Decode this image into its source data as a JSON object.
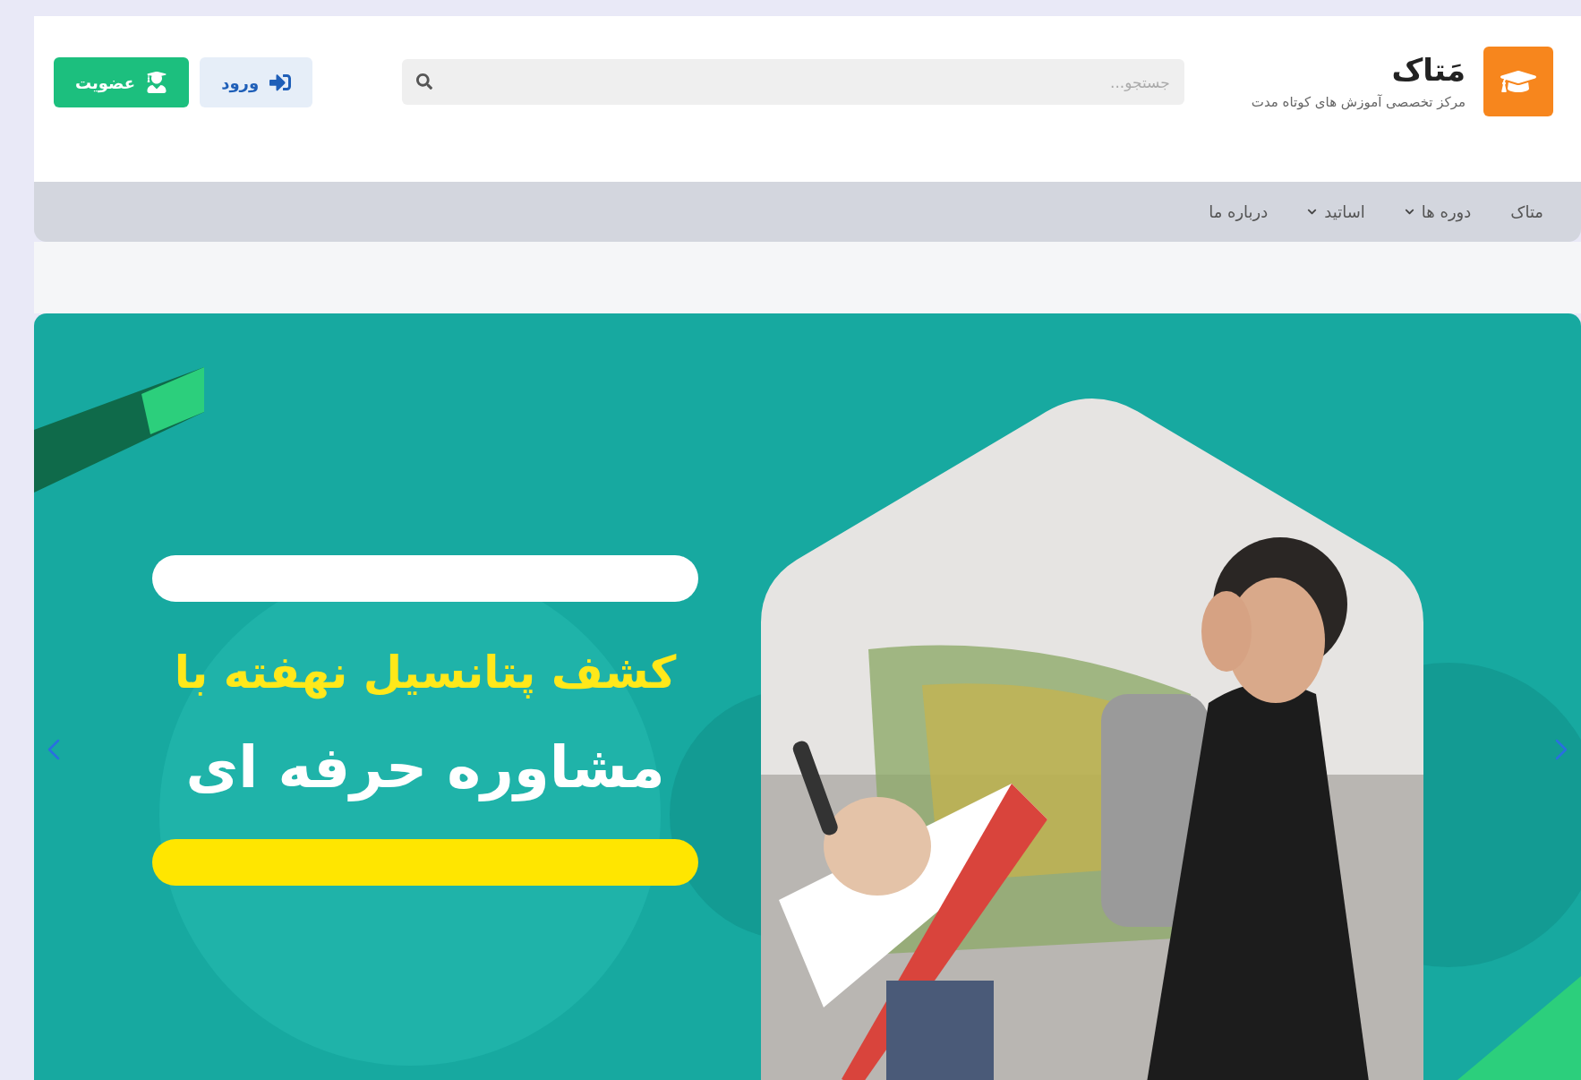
{
  "brand": {
    "title": "مَتاک",
    "subtitle": "مرکز تخصصی آموزش های کوتاه مدت"
  },
  "search": {
    "placeholder": "جستجو..."
  },
  "buttons": [
    {
      "label": "ورود",
      "kind": "login"
    },
    {
      "label": "عضویت",
      "kind": "signup"
    }
  ],
  "nav": [
    {
      "label": "متاک",
      "dropdown": false
    },
    {
      "label": "دوره ها",
      "dropdown": true
    },
    {
      "label": "اساتید",
      "dropdown": true
    },
    {
      "label": "درباره ما",
      "dropdown": false
    }
  ],
  "banner": {
    "headline": "کشف پتانسیل نهفته با",
    "subheadline": "مشاوره حرفه ای"
  }
}
